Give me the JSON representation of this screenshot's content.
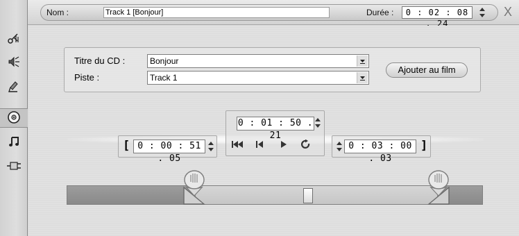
{
  "header": {
    "name_label": "Nom :",
    "name_value": "Track 1 [Bonjour]",
    "duration_label": "Durée :",
    "duration_value": "0 : 02 : 08 . 24",
    "close_label": "X"
  },
  "sidebar": {
    "tools": [
      {
        "name": "audio-scissors-icon"
      },
      {
        "name": "speaker-icon"
      },
      {
        "name": "microphone-icon"
      },
      {
        "name": "cd-icon",
        "active": true
      },
      {
        "name": "music-note-icon"
      },
      {
        "name": "plug-icon"
      }
    ]
  },
  "cd": {
    "title_label": "Titre du CD :",
    "title_value": "Bonjour",
    "track_label": "Piste :",
    "track_value": "Track 1",
    "add_button": "Ajouter au film"
  },
  "transport": {
    "position": "0 : 01 : 50 . 21",
    "in_point": "0 : 00 : 51 . 05",
    "out_point": "0 : 03 : 00 . 03",
    "open_bracket": "[",
    "close_bracket": "]"
  },
  "trim": {
    "in_fraction": 0.31,
    "out_fraction": 0.89,
    "playhead_fraction": 0.58
  },
  "colors": {
    "panel": "#e0e0e0",
    "track_unselected": "#909090",
    "track_selected": "#cfcfcf"
  }
}
